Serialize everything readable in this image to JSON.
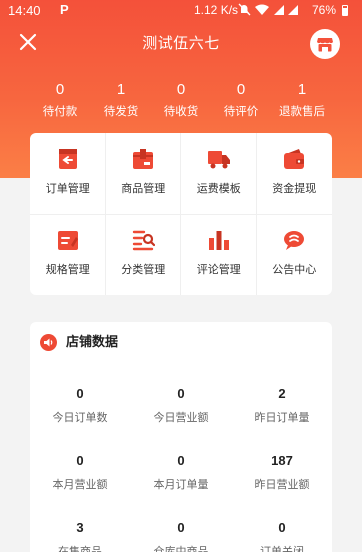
{
  "status_bar": {
    "time": "14:40",
    "app_icon": "P",
    "speed": "1.12 K/s",
    "battery": "76%"
  },
  "nav": {
    "title": "测试伍六七",
    "close_icon": "close-icon",
    "shop_icon": "shop-icon"
  },
  "order_stats": [
    {
      "count": "0",
      "label": "待付款"
    },
    {
      "count": "1",
      "label": "待发货"
    },
    {
      "count": "0",
      "label": "待收货"
    },
    {
      "count": "0",
      "label": "待评价"
    },
    {
      "count": "1",
      "label": "退款售后"
    }
  ],
  "menu": [
    {
      "label": "订单管理",
      "icon": "order-icon"
    },
    {
      "label": "商品管理",
      "icon": "product-icon"
    },
    {
      "label": "运费模板",
      "icon": "truck-icon"
    },
    {
      "label": "资金提现",
      "icon": "wallet-icon"
    },
    {
      "label": "规格管理",
      "icon": "spec-icon"
    },
    {
      "label": "分类管理",
      "icon": "category-icon"
    },
    {
      "label": "评论管理",
      "icon": "chart-icon"
    },
    {
      "label": "公告中心",
      "icon": "chat-icon"
    }
  ],
  "store_data": {
    "title": "店铺数据",
    "stats": [
      {
        "value": "0",
        "label": "今日订单数"
      },
      {
        "value": "0",
        "label": "今日营业额"
      },
      {
        "value": "2",
        "label": "昨日订单量"
      },
      {
        "value": "0",
        "label": "本月营业额"
      },
      {
        "value": "0",
        "label": "本月订单量"
      },
      {
        "value": "187",
        "label": "昨日营业额"
      },
      {
        "value": "3",
        "label": "在售商品"
      },
      {
        "value": "0",
        "label": "仓库中商品"
      },
      {
        "value": "0",
        "label": "订单关闭"
      }
    ]
  },
  "colors": {
    "accent": "#f4513a",
    "accent_light": "#fb7f46",
    "icon": "#ee4a35"
  }
}
